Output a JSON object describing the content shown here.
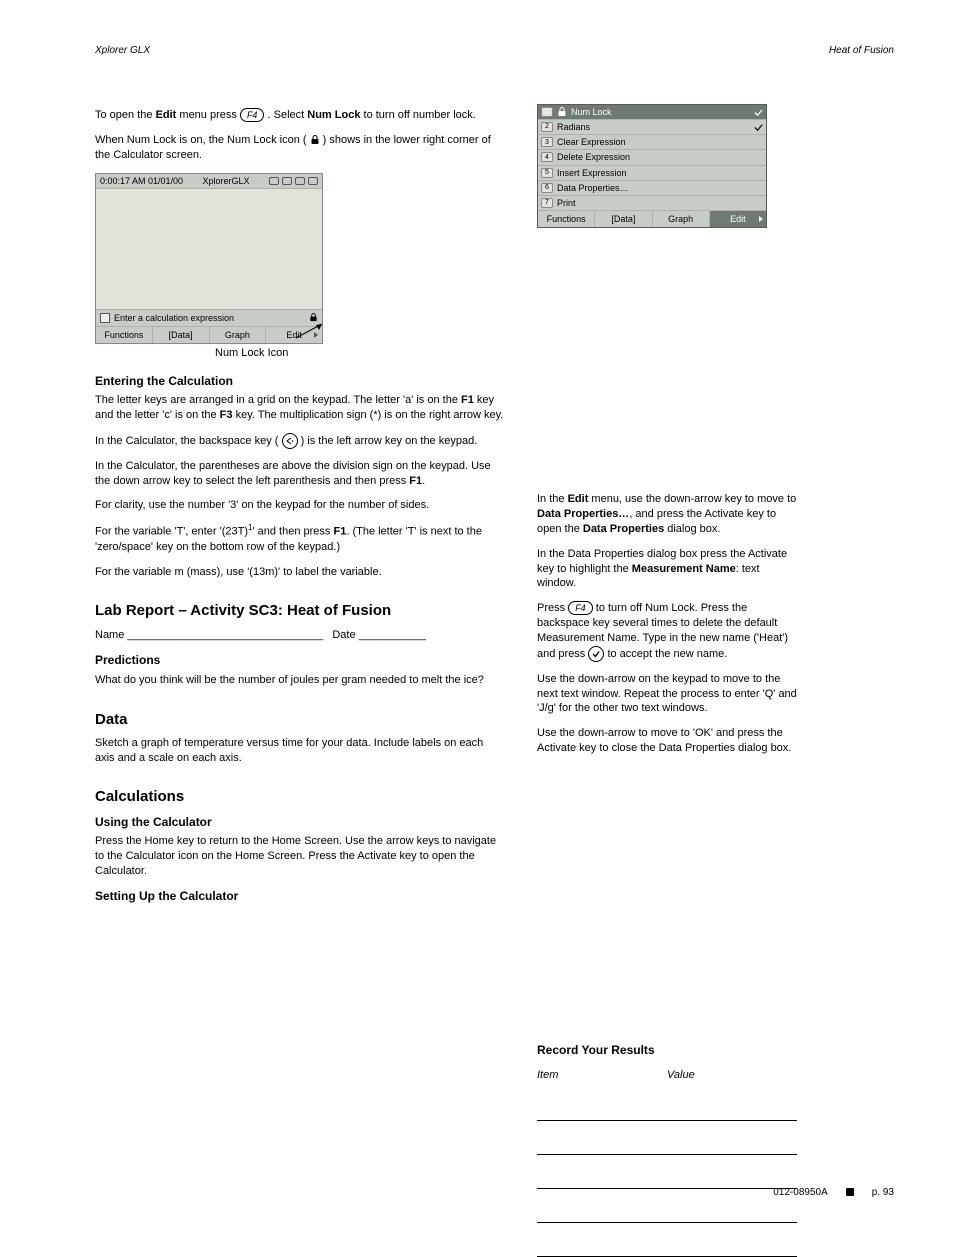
{
  "header": {
    "left": "Xplorer GLX",
    "right": "Heat of Fusion"
  },
  "menu": {
    "titleIcon": "lock-icon",
    "title": "Num Lock",
    "items": [
      {
        "n": "2",
        "label": "Radians",
        "checked": true
      },
      {
        "n": "3",
        "label": "Clear Expression",
        "checked": false
      },
      {
        "n": "4",
        "label": "Delete Expression",
        "checked": false
      },
      {
        "n": "5",
        "label": "Insert Expression",
        "checked": false
      },
      {
        "n": "6",
        "label": "Data Properties…",
        "checked": false
      },
      {
        "n": "7",
        "label": "Print",
        "checked": false
      }
    ],
    "bottom": [
      "Functions",
      "[Data]",
      "Graph",
      "Edit"
    ]
  },
  "left": {
    "p0a": "To open the",
    "p0edit": "Edit",
    "p0b": " menu press ",
    "p0c": ". Select ",
    "p0numlock": "Num Lock",
    "p0d": " to turn off number lock.",
    "p1a": "When Num Lock is on, the Num Lock icon (",
    "p1b": ") shows in the lower right corner of the Calculator screen.",
    "shot": {
      "time": "0:00:17 AM  01/01/00",
      "title": "XplorerGLX",
      "hint": "Enter a calculation expression",
      "tabs": [
        "Functions",
        "[Data]",
        "Graph",
        "Edit"
      ]
    },
    "shotCaption": "Num Lock Icon",
    "h_enter": "Entering the Calculation",
    "s1a": "The letter keys are arranged in a grid on the keypad. The letter 'a' is on the ",
    "s1key1": "F1",
    "s1b": " key and the letter 'c' is on the ",
    "s1key2": "F3",
    "s1c": " key. The multiplication sign (*) is on the right arrow key.",
    "s2a": "In the Calculator, the backspace key (",
    "s2b": ") is the left arrow key on the keypad.",
    "s3a": "In the Calculator, the parentheses are above the division sign on the keypad. Use the down arrow key to select the left parenthesis and then press ",
    "s3key": "F1",
    "s3b": ".",
    "s4": "For clarity, use the number '3' on the keypad for the number of sides.",
    "s5a": "For the variable 'T', enter '(23T)",
    "s5b": "' and then press ",
    "s5key": "F1",
    "s5c": ". (The letter 'T' is next to the 'zero/space' key on the bottom row of the keypad.)",
    "s6": "For the variable m (mass), use '(13m)' to label the variable.",
    "h_lab": "Lab Report – Activity SC3: Heat of Fusion",
    "lab_name": "Name ",
    "lab_date": "Date ",
    "h_pred": "Predictions",
    "pred_q": "What do you think will be the number of joules per gram needed to melt the ice?",
    "h_data": "Data",
    "d_sketch": "Sketch a graph of temperature versus time for your data. Include labels on each axis and a scale on each axis.",
    "h_calc": "Calculations",
    "c_head": "Using the Calculator",
    "c_open": "Press the Home key to return to the Home Screen. Use the arrow keys to navigate to the Calculator icon on the Home Screen. Press the Activate key to open the Calculator.",
    "c_setup": "Setting Up the Calculator"
  },
  "right": {
    "r1a": "In the ",
    "r1edit": "Edit",
    "r1b": " menu, use the down-arrow key to move to ",
    "r1dp": "Data Properties…",
    "r1c": ", and press the Activate key to open the ",
    "r1dpd": "Data Properties",
    "r1d": " dialog box.",
    "r2a": "In the Data Properties dialog box press the Activate key to highlight the ",
    "r2mn": "Measurement Name",
    "r2b": ": text window.",
    "r3a": "Press ",
    "r3b": " to turn off Num Lock. Press the backspace key several times to delete the default Measurement Name. Type in the new name ('Heat') and press ",
    "r3c": " to accept the new name.",
    "r4": "Use the down-arrow on the keypad to move to the next text window. Repeat the process to enter 'Q' and 'J/g' for the other two text windows.",
    "r5": "Use the down-arrow to move to 'OK' and press the Activate key to close the Data Properties dialog box.",
    "h_rec": "Record Your Results",
    "recTable": {
      "h1": "Item",
      "h2": "Value",
      "rows": 5
    }
  },
  "footer": {
    "code": "012-08950A",
    "page": "p. 93"
  }
}
